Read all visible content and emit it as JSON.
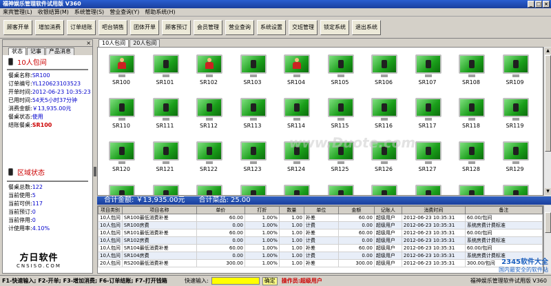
{
  "window": {
    "title": "福神娱乐管理软件试用版 V360"
  },
  "menu": [
    "来宾管理(L)",
    "收银结算(M)",
    "系统管理(S)",
    "营业查询(Y)",
    "帮助系统(H)"
  ],
  "toolbar": [
    "顾客开单",
    "增加消费",
    "订单结账",
    "吧台销售",
    "团体开单",
    "顾客预订",
    "会员管理",
    "营业查询",
    "系统设置",
    "交班管理",
    "锁定系统",
    "退出系统"
  ],
  "left": {
    "tabs": [
      "状态",
      "记事",
      "产品消息"
    ],
    "room_title": "10人包间",
    "info": [
      {
        "label": "餐桌名称:",
        "value": "SR100",
        "style": "val"
      },
      {
        "label": "订单编号:",
        "value": "YL120623103523",
        "style": "val"
      },
      {
        "label": "开单时间:",
        "value": "2012-06-23 10:35:23",
        "style": "val"
      },
      {
        "label": "已用时间:",
        "value": "54天5小时37分钟",
        "style": "val"
      },
      {
        "label": "消费金额:",
        "value": "￥13,935.00元",
        "style": "val"
      },
      {
        "label": "餐桌状态:",
        "value": "使用",
        "style": "val"
      },
      {
        "label": "结账餐桌:",
        "value": "SR100",
        "style": "red"
      }
    ],
    "area_title": "区域状态",
    "area": [
      {
        "label": "餐桌总数:",
        "value": "122"
      },
      {
        "label": "当前使用:",
        "value": "5"
      },
      {
        "label": "当前可供:",
        "value": "117"
      },
      {
        "label": "当前预订:",
        "value": "0"
      },
      {
        "label": "当前停用:",
        "value": "0"
      },
      {
        "label": "计使用率:",
        "value": "4.10%"
      }
    ],
    "logo_big": "方日软件",
    "logo_small": "CNSISO.COM"
  },
  "room_tabs": [
    "10人包间",
    "20人包间"
  ],
  "rooms": [
    "SR100",
    "SR101",
    "SR102",
    "SR103",
    "SR104",
    "SR105",
    "SR106",
    "SR107",
    "SR108",
    "SR109",
    "SR110",
    "SR111",
    "SR112",
    "SR113",
    "SR114",
    "SR115",
    "SR116",
    "SR117",
    "SR118",
    "SR119",
    "SR120",
    "SR121",
    "SR122",
    "SR123",
    "SR124",
    "SR125",
    "SR126",
    "SR127",
    "SR128",
    "SR129",
    "",
    "",
    "",
    "",
    "",
    "",
    "",
    "",
    "",
    ""
  ],
  "occupied": [
    "SR100",
    "SR102",
    "SR104"
  ],
  "totals": {
    "amount": "合计金额: ￥13,935.00元",
    "items": "合计菜品: 25.00"
  },
  "table": {
    "headers": [
      "项目类别",
      "项目名称",
      "单价",
      "打折",
      "数量",
      "单位",
      "金额",
      "记账人",
      "消费时间",
      "备注"
    ],
    "rows": [
      [
        "10人包间",
        "SR100最低消费补差",
        "60.00",
        "1.00%",
        "1.00",
        "补差",
        "60.00",
        "超级用户",
        "2012-06-23 10:35:31",
        "60.00/包间"
      ],
      [
        "10人包间",
        "SR100房费",
        "0.00",
        "1.00%",
        "1.00",
        "计费",
        "0.00",
        "超级用户",
        "2012-06-23 10:35:31",
        "系统房费计费标准"
      ],
      [
        "10人包间",
        "SR101最低消费补差",
        "60.00",
        "1.00%",
        "1.00",
        "补差",
        "60.00",
        "超级用户",
        "2012-06-23 10:35:31",
        "60.00/包间"
      ],
      [
        "10人包间",
        "SR102房费",
        "0.00",
        "1.00%",
        "1.00",
        "计费",
        "0.00",
        "超级用户",
        "2012-06-23 10:35:31",
        "系统房费计费标准"
      ],
      [
        "10人包间",
        "SR104最低消费补差",
        "60.00",
        "1.00%",
        "1.00",
        "补差",
        "60.00",
        "超级用户",
        "2012-06-23 10:35:31",
        "60.00/包间"
      ],
      [
        "10人包间",
        "SR104房费",
        "0.00",
        "1.00%",
        "1.00",
        "计费",
        "0.00",
        "超级用户",
        "2012-06-23 10:35:31",
        "系统房费计费标准"
      ],
      [
        "20人包间",
        "RS200最低消费补差",
        "300.00",
        "1.00%",
        "1.00",
        "补差",
        "300.00",
        "超级用户",
        "2012-06-23 10:35:31",
        "300.00/包间"
      ]
    ]
  },
  "status": {
    "keys": "F1-快速输入; F2-开单; F3-增加消费; F6-订单结账; F7-打开钱箱",
    "quick_label": "快速输入:",
    "ok": "确定",
    "operator": "操作员:超级用户",
    "app": "福神娱乐管理软件试用版 V360"
  },
  "watermark": "www.Duote.com",
  "badge": {
    "line1": "2345软件大全",
    "line2": "国内最安全的软件站"
  }
}
